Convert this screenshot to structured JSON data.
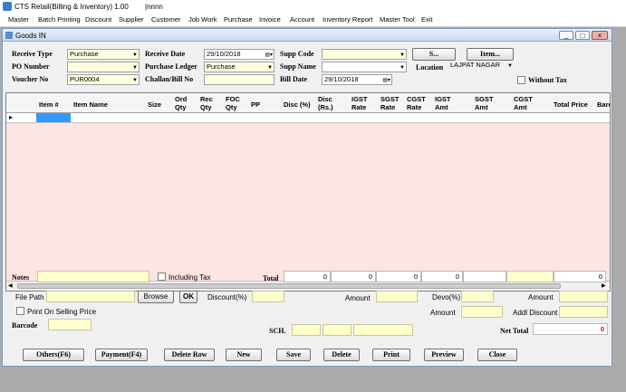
{
  "window": {
    "title": "CTS Retail(Billing & Inventory) 1.00",
    "user": "|nnnn"
  },
  "menu": [
    "Master",
    "Batch Printing",
    "Discount",
    "Supplier",
    "Customer",
    "Job Work",
    "Purchase",
    "Invoice",
    "Account",
    "Inventory Report",
    "Master Tool",
    "Exit"
  ],
  "child": {
    "title": "Goods IN",
    "controls": [
      "_",
      "□",
      "×"
    ]
  },
  "header": {
    "receive_type_label": "Receive Type",
    "receive_type_value": "Purchase",
    "po_number_label": "PO Number",
    "po_number_value": "",
    "voucher_no_label": "Voucher No",
    "voucher_no_value": "PUR0004",
    "receive_date_label": "Receive Date",
    "receive_date_value": "29/10/2018",
    "purchase_ledger_label": "Purchase Ledger",
    "purchase_ledger_value": "Purchase",
    "challan_label": "Challan/Bill No",
    "challan_value": "",
    "supp_code_label": "Supp Code",
    "supp_code_value": "",
    "supp_name_label": "Supp Name",
    "supp_name_value": "",
    "bill_date_label": "Bill Date",
    "bill_date_value": "29/10/2018",
    "s_button": "S...",
    "item_button": "Item...",
    "location_label": "Location",
    "location_value": "LAJPAT NAGAR",
    "without_tax_label": "Without Tax"
  },
  "grid": {
    "columns": [
      "Item #",
      "Item Name",
      "Size",
      "Ord Qty",
      "Rec Qty",
      "FOC Qty",
      "PP",
      "Disc (%)",
      "Disc (Rs.)",
      "IGST Rate",
      "SGST Rate",
      "CGST Rate",
      "IGST Amt",
      "SGST Amt",
      "CGST Amt",
      "Total Price",
      "Barco"
    ],
    "row_marker": "▸"
  },
  "totals": {
    "notes_label": "Notes",
    "including_tax_label": "Including Tax",
    "total_label": "Total",
    "t1": "0",
    "t2": "0",
    "t3": "0",
    "t4": "0",
    "t5": "0"
  },
  "footer": {
    "file_path_label": "File Path",
    "browse_button": "Browse",
    "ok_button": "OK",
    "discount_label": "Discount(%)",
    "amount_label": "Amount",
    "devo_label": "Devo(%)",
    "amount2_label": "Amount",
    "amount3_label": "Amount",
    "addl_discount_label": "Addl Discount",
    "print_selling_label": "Print On Selling Price",
    "barcode_label": "Barcode",
    "sch_label": "SCH.",
    "net_total_label": "Net Total",
    "net_total_value": "0"
  },
  "buttons": [
    "Others(F6)",
    "Payment(F4)",
    "Delete Row",
    "New",
    "Save",
    "Delete",
    "Print",
    "Preview",
    "Close"
  ]
}
